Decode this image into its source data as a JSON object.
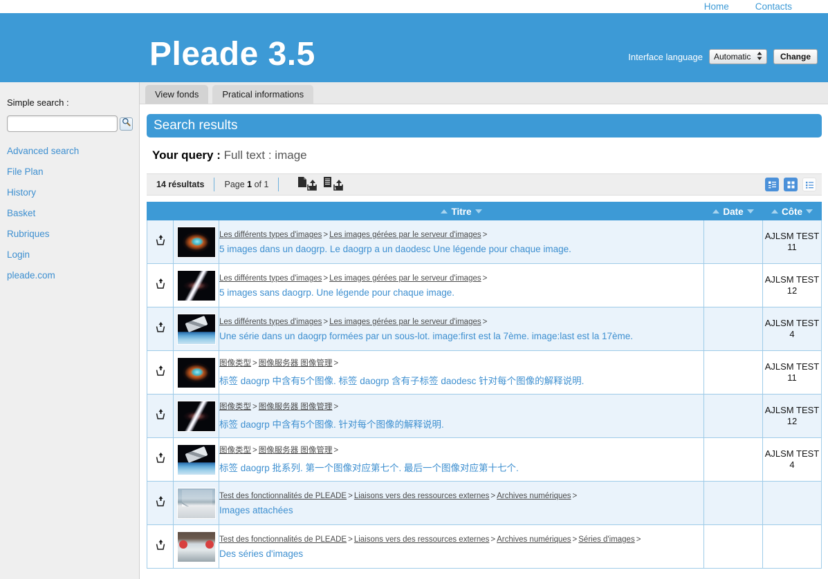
{
  "topnav": {
    "items": [
      {
        "label": "Home"
      },
      {
        "label": "Contacts"
      }
    ]
  },
  "banner": {
    "logo": "Pleade 3.5",
    "language_label": "Interface language",
    "language_value": "Automatic",
    "change_button": "Change"
  },
  "sidebar": {
    "search_label": "Simple search :",
    "search_value": "",
    "search_placeholder": "",
    "search_button_icon": "magnifier-icon",
    "items": [
      {
        "label": "Advanced search"
      },
      {
        "label": "File Plan"
      },
      {
        "label": "History"
      },
      {
        "label": "Basket"
      },
      {
        "label": "Rubriques"
      },
      {
        "label": "Login"
      },
      {
        "label": "pleade.com"
      }
    ]
  },
  "tabs": [
    {
      "label": "View fonds",
      "active": true
    },
    {
      "label": "Pratical informations",
      "active": false
    }
  ],
  "main": {
    "results_title": "Search results",
    "query_label": "Your query :",
    "query_value": "Full text : image",
    "toolbar": {
      "count": "14 résultats",
      "page_prefix": "Page",
      "page_current": "1",
      "page_of": "of",
      "page_total": "1",
      "export_doc_icon": "add-document-to-basket-icon",
      "export_all_icon": "add-all-documents-to-basket-icon",
      "viewmodes": [
        {
          "icon": "list-with-thumbnails-view-icon",
          "active": true
        },
        {
          "icon": "grid-view-icon",
          "active": true
        },
        {
          "icon": "compact-list-view-icon",
          "active": false
        }
      ]
    },
    "columns": [
      {
        "key": "basket",
        "label": ""
      },
      {
        "key": "thumb",
        "label": ""
      },
      {
        "key": "title",
        "label": "Titre",
        "sortable": true
      },
      {
        "key": "date",
        "label": "Date",
        "sortable": true
      },
      {
        "key": "cote",
        "label": "Côte",
        "sortable": true
      }
    ],
    "rows": [
      {
        "basket_icon": "add-to-basket-icon",
        "thumb": "th-nebula",
        "thumb_name": "thumbnail-crab-nebula",
        "crumbs": [
          "Les différents types d'images",
          "Les images gérées par le serveur d'images"
        ],
        "title": "5 images dans un daogrp. Le daogrp a un daodesc Une légende pour chaque image.",
        "date": "",
        "cote": "AJLSM TEST 11"
      },
      {
        "basket_icon": "add-to-basket-icon",
        "thumb": "th-galaxy",
        "thumb_name": "thumbnail-galaxy",
        "crumbs": [
          "Les différents types d'images",
          "Les images gérées par le serveur d'images"
        ],
        "title": "5 images sans daogrp. Une légende pour chaque image.",
        "date": "",
        "cote": "AJLSM TEST 12"
      },
      {
        "basket_icon": "add-to-basket-icon",
        "thumb": "th-hubble",
        "thumb_name": "thumbnail-hubble-telescope",
        "crumbs": [
          "Les différents types d'images",
          "Les images gérées par le serveur d'images"
        ],
        "title": "Une série dans un daogrp formées par un sous-lot. image:first est la 7ème. image:last est la 17ème.",
        "date": "",
        "cote": "AJLSM TEST 4"
      },
      {
        "basket_icon": "add-to-basket-icon",
        "thumb": "th-nebula",
        "thumb_name": "thumbnail-crab-nebula",
        "crumbs": [
          "图像类型",
          "图像服务器 图像管理"
        ],
        "title": "标签 daogrp 中含有5个图像. 标签 daogrp 含有子标签 daodesc 针对每个图像的解释说明.",
        "date": "",
        "cote": "AJLSM TEST 11"
      },
      {
        "basket_icon": "add-to-basket-icon",
        "thumb": "th-galaxy",
        "thumb_name": "thumbnail-galaxy",
        "crumbs": [
          "图像类型",
          "图像服务器 图像管理"
        ],
        "title": "标签 daogrp 中含有5个图像. 针对每个图像的解释说明.",
        "date": "",
        "cote": "AJLSM TEST 12"
      },
      {
        "basket_icon": "add-to-basket-icon",
        "thumb": "th-hubble",
        "thumb_name": "thumbnail-hubble-telescope",
        "crumbs": [
          "图像类型",
          "图像服务器 图像管理"
        ],
        "title": "标签 daogrp 批系列. 第一个图像对应第七个. 最后一个图像对应第十七个.",
        "date": "",
        "cote": "AJLSM TEST 4"
      },
      {
        "basket_icon": "add-to-basket-icon",
        "thumb": "th-boat1",
        "thumb_name": "thumbnail-sailboat-deck",
        "crumbs": [
          "Test des fonctionnalités de PLEADE",
          "Liaisons vers des ressources externes",
          "Archives numériques"
        ],
        "title": "Images attachées",
        "date": "",
        "cote": ""
      },
      {
        "basket_icon": "add-to-basket-icon",
        "thumb": "th-boat2",
        "thumb_name": "thumbnail-sailboat-interior",
        "crumbs": [
          "Test des fonctionnalités de PLEADE",
          "Liaisons vers des ressources externes",
          "Archives numériques",
          "Séries d'images"
        ],
        "title": "Des séries d'images",
        "date": "",
        "cote": ""
      }
    ]
  },
  "colors": {
    "brand_blue": "#3d9ad6",
    "link_blue": "#3d8fd0",
    "row_alt": "#eaf3fb",
    "cell_border": "#9ecbe8",
    "sidebar_bg": "#efefef"
  }
}
